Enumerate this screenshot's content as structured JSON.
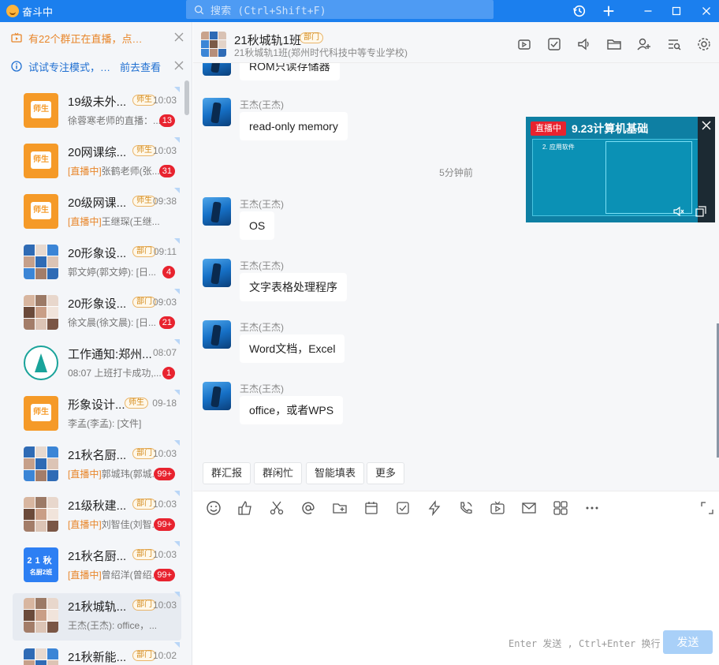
{
  "titlebar": {
    "app_status": "奋斗中",
    "search_placeholder": "搜索 (Ctrl+Shift+F)"
  },
  "notices": {
    "live": "有22个群正在直播，点…",
    "focus": "试试专注模式，…",
    "focus_link": "前去查看"
  },
  "chats": [
    {
      "name": "19级未外...",
      "tag": "师生",
      "time": "10:03",
      "preview": "徐蓉寒老师的直播：...",
      "badge": "13",
      "avatar": "orange"
    },
    {
      "name": "20网课综...",
      "tag": "师生",
      "time": "10:03",
      "live_prefix": "[直播中]",
      "preview": "张鹤老师(张...",
      "badge": "31",
      "avatar": "orange"
    },
    {
      "name": "20级网课...",
      "tag": "师生",
      "time": "09:38",
      "live_prefix": "[直播中]",
      "preview": "王继琛(王继...",
      "badge": "",
      "avatar": "orange"
    },
    {
      "name": "20形象设...",
      "tag": "部门",
      "time": "09:11",
      "preview": "郭文婷(郭文婷): [日...",
      "badge": "4",
      "avatar": "mosaic"
    },
    {
      "name": "20形象设...",
      "tag": "部门",
      "time": "09:03",
      "preview": "徐文晨(徐文晨): [日...",
      "badge": "21",
      "avatar": "mosaic"
    },
    {
      "name": "工作通知:郑州...",
      "tag": "",
      "time": "08:07",
      "preview": "08:07 上班打卡成功,...",
      "badge": "1",
      "avatar": "logo"
    },
    {
      "name": "形象设计...",
      "tag": "师生",
      "time": "09-18",
      "preview": "李孟(李孟): [文件]",
      "badge": "",
      "avatar": "orange"
    },
    {
      "name": "21秋名厨...",
      "tag": "部门",
      "time": "10:03",
      "live_prefix": "[直播中]",
      "preview": "郭城玮(郭城...",
      "badge": "99+",
      "avatar": "mosaic"
    },
    {
      "name": "21级秋建...",
      "tag": "部门",
      "time": "10:03",
      "live_prefix": "[直播中]",
      "preview": "刘智佳(刘智...",
      "badge": "99+",
      "avatar": "mosaic"
    },
    {
      "name": "21秋名厨...",
      "tag": "部门",
      "time": "10:03",
      "live_prefix": "[直播中]",
      "preview": "曾绍洋(曾绍...",
      "badge": "99+",
      "avatar": "blue2",
      "avatar_l1": "21秋",
      "avatar_l2": "名厨2班"
    },
    {
      "name": "21秋城轨...",
      "tag": "部门",
      "time": "10:03",
      "preview": "王杰(王杰): office，...",
      "badge": "",
      "avatar": "mosaic",
      "selected": true
    },
    {
      "name": "21秋新能...",
      "tag": "部门",
      "time": "10:02",
      "preview": "",
      "badge": "",
      "avatar": "mosaic"
    }
  ],
  "avatar_labels": {
    "orange": "师生"
  },
  "header": {
    "title": "21秋城轨1班",
    "tag": "部门",
    "subtitle": "21秋城轨1班(郑州时代科技中等专业学校)"
  },
  "messages": {
    "top_partial": "ROM只读存储器",
    "time_separator": "5分钟前",
    "items": [
      {
        "sender": "王杰(王杰)",
        "text": "read-only memory"
      },
      {
        "sender": "王杰(王杰)",
        "text": "OS"
      },
      {
        "sender": "王杰(王杰)",
        "text": "文字表格处理程序"
      },
      {
        "sender": "王杰(王杰)",
        "text": "Word文档，Excel"
      },
      {
        "sender": "王杰(王杰)",
        "text": "office，或者WPS"
      }
    ]
  },
  "live_video": {
    "chip": "直播中",
    "title": "9.23计算机基础",
    "slide_heading": "2. 应用软件"
  },
  "quick_actions": [
    "群汇报",
    "群闲忙",
    "智能填表",
    "更多"
  ],
  "input": {
    "hint": "Enter 发送 , Ctrl+Enter 换行",
    "send_label": "发送"
  },
  "colors": {
    "titlebar": "#1b7fee",
    "badge": "#e8232f",
    "live_orange": "#e8862a",
    "send_disabled": "#a9d0f8"
  }
}
